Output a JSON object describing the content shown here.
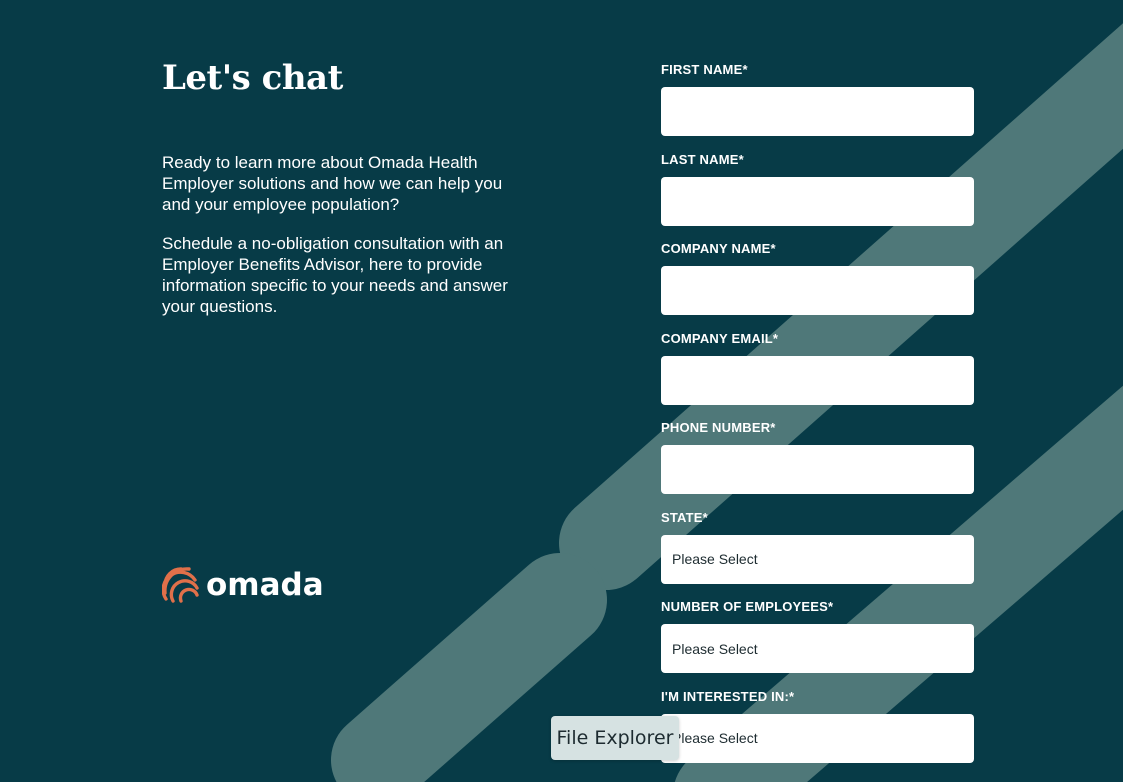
{
  "heading": "Let's chat",
  "intro_paragraph": "Ready to learn more about Omada Health Employer solutions and how we can help you and your employee population?",
  "schedule_paragraph": "Schedule a no-obligation consultation with an Employer Benefits Advisor, here to provide information specific to your needs and answer your questions.",
  "logo": {
    "text": "omada",
    "icon": "omada-logo-icon"
  },
  "form": {
    "first_name_label": "FIRST NAME*",
    "last_name_label": "LAST NAME*",
    "company_name_label": "COMPANY NAME*",
    "company_email_label": "COMPANY EMAIL*",
    "phone_number_label": "PHONE NUMBER*",
    "state_label": "STATE*",
    "state_value": "Please Select",
    "employees_label": "NUMBER OF EMPLOYEES*",
    "employees_value": "Please Select",
    "interested_label": "I'M INTERESTED IN:*",
    "interested_value": "Please Select"
  },
  "tooltip": "File Explorer",
  "colors": {
    "background": "#073b47",
    "stripe": "#4f7879",
    "logo_orange": "#e0704a",
    "input_bg": "#ffffff"
  }
}
